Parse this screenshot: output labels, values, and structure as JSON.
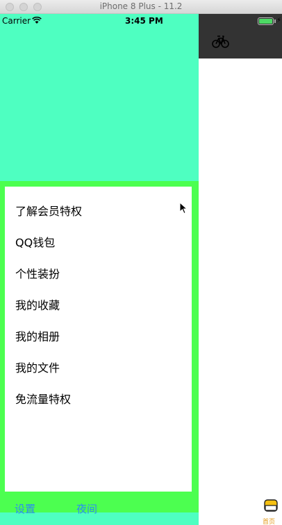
{
  "window": {
    "title": "iPhone 8 Plus - 11.2"
  },
  "status_bar": {
    "carrier": "Carrier",
    "time": "3:45 PM",
    "battery_color": "#4cd964"
  },
  "drawer": {
    "background": "#4effc1",
    "frame_color": "#4cff50",
    "menu_items": [
      "了解会员特权",
      "QQ钱包",
      "个性装扮",
      "我的收藏",
      "我的相册",
      "我的文件",
      "免流量特权"
    ],
    "footer": {
      "settings_label": "设置",
      "night_label": "夜间"
    }
  },
  "main": {
    "navbar_color": "#333333",
    "nav_icon": "bicycle-icon",
    "tab_bar": {
      "home_label": "首页",
      "home_icon": "shop-icon"
    }
  }
}
